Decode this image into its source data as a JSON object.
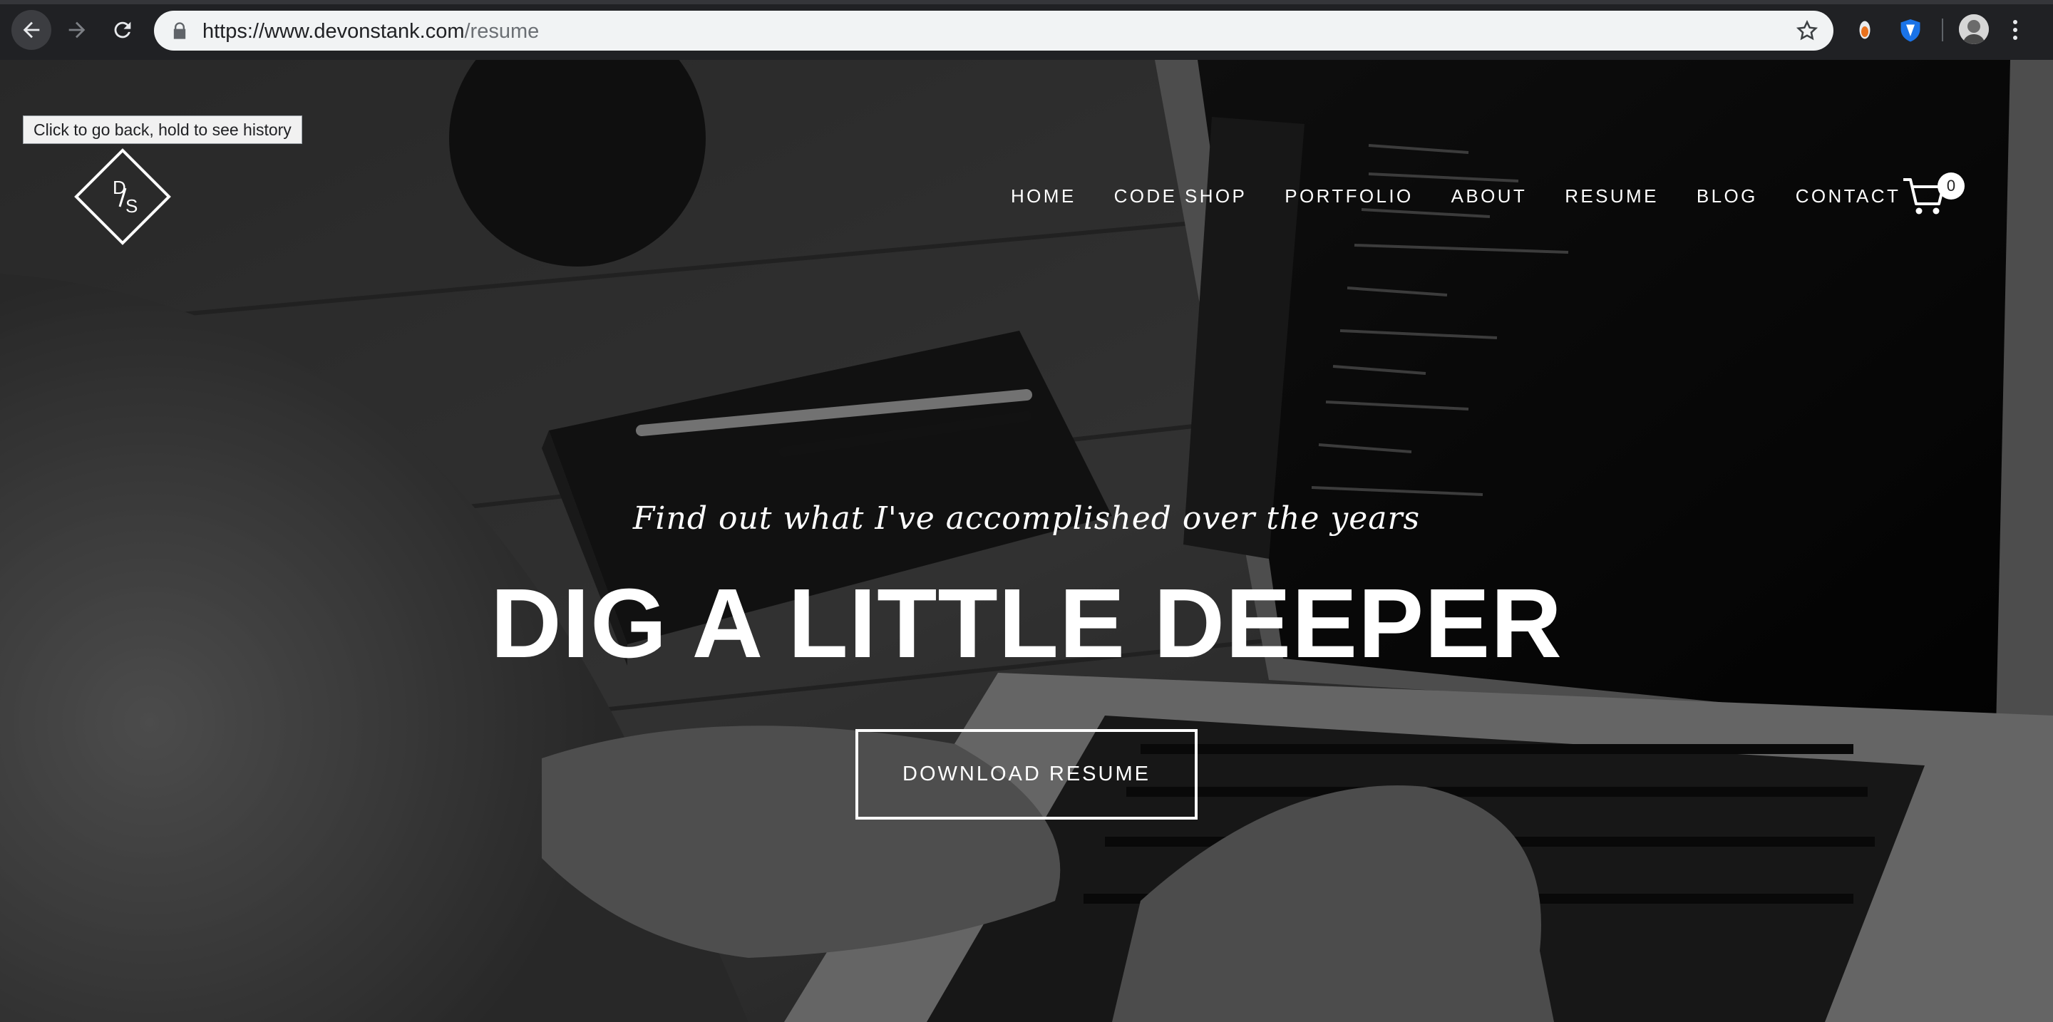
{
  "browser": {
    "url_host": "https://www.devonstank.com",
    "url_path": "/resume",
    "back_tooltip": "Click to go back, hold to see history"
  },
  "site": {
    "logo_letters": "D/S",
    "nav": [
      {
        "label": "HOME"
      },
      {
        "label": "CODE SHOP"
      },
      {
        "label": "PORTFOLIO"
      },
      {
        "label": "ABOUT"
      },
      {
        "label": "RESUME"
      },
      {
        "label": "BLOG"
      },
      {
        "label": "CONTACT"
      }
    ],
    "cart_count": "0"
  },
  "hero": {
    "tagline": "Find out what I've accomplished over the years",
    "headline": "DIG A LITTLE DEEPER",
    "button_label": "DOWNLOAD RESUME"
  },
  "icons": {
    "back": "arrow-left-icon",
    "forward": "arrow-right-icon",
    "reload": "reload-icon",
    "lock": "lock-icon",
    "bookmark": "star-icon",
    "cart": "cart-icon",
    "menu": "more-vert-icon"
  },
  "colors": {
    "chrome_bg": "#202124",
    "omnibox_bg": "#f1f3f4",
    "hero_text": "#ffffff"
  }
}
